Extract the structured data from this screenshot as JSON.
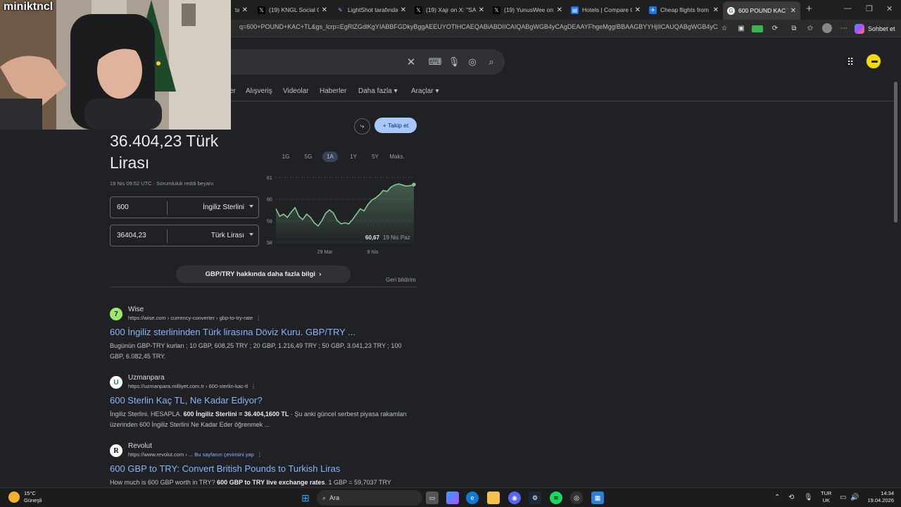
{
  "browser": {
    "tabs": [
      {
        "title": "tarafından",
        "icon": "lightshot-icon",
        "color": "#a06cd5"
      },
      {
        "title": "(19) KNGL Social Co",
        "icon": "x-icon",
        "color": "#000000"
      },
      {
        "title": "LightShot tarafından",
        "icon": "lightshot-icon",
        "color": "#a06cd5"
      },
      {
        "title": "(19) Xajr on X: \"SAD",
        "icon": "x-icon",
        "color": "#000000"
      },
      {
        "title": "(19) YunusWee on X",
        "icon": "x-icon",
        "color": "#000000"
      },
      {
        "title": "Hotels | Compare Ch",
        "icon": "hotels-icon",
        "color": "#1a73e8"
      },
      {
        "title": "Cheap flights from",
        "icon": "flights-icon",
        "color": "#1a73e8"
      },
      {
        "title": "600 POUND KAC TL",
        "icon": "google-icon",
        "color": "#ffffff",
        "active": true
      }
    ],
    "url": "q=600+POUND+KAC+TL&gs_lcrp=EgRlZGdlKgYIABBFGDkyBggAEEUYOTIHCAEQABiABDIICAIQABgWGB4yCAgDEAAYFhgeMggIBBAAGBYYHjIICAUQABgWGB4yCAgG...",
    "copilot_label": "Sohbet et"
  },
  "search": {
    "nav": [
      "er",
      "Alışveriş",
      "Videolar",
      "Haberler",
      "Daha fazla",
      "Araçlar"
    ],
    "follow_label": "Takip et"
  },
  "converter": {
    "result_line1": "36.404,23 Türk",
    "result_line2": "Lirası",
    "stamp": "19 Nis 09:52 UTC · Sorumluluk reddi beyanı",
    "from_amount": "600",
    "from_currency": "İngiliz Sterlini",
    "to_amount": "36404,23",
    "to_currency": "Türk Lirası",
    "ranges": [
      "1G",
      "5G",
      "1A",
      "1Y",
      "5Y",
      "Maks."
    ],
    "selected_range": "1A",
    "more_info": "GBP/TRY hakkında daha fazla bilgi",
    "feedback": "Geri bildirim"
  },
  "chart_data": {
    "type": "line",
    "title": "",
    "x_labels": [
      "29 Mar",
      "9 Nis"
    ],
    "y_ticks": [
      58,
      59,
      60,
      61
    ],
    "ylim": [
      58,
      61
    ],
    "values": [
      59.55,
      59.2,
      59.3,
      59.15,
      59.4,
      59.6,
      59.2,
      59.05,
      59.3,
      59.15,
      58.9,
      58.75,
      59.0,
      59.35,
      59.5,
      59.35,
      59.0,
      58.85,
      58.9,
      58.85,
      59.05,
      59.3,
      59.55,
      59.45,
      59.75,
      59.95,
      60.05,
      60.2,
      60.4,
      60.35,
      60.55,
      60.65,
      60.7,
      60.65,
      60.6,
      60.62,
      60.67
    ],
    "current_value": "60,67",
    "current_date": "19 Nis Paz",
    "line_color": "#81c995"
  },
  "results": [
    {
      "site": "Wise",
      "url": "https://wise.com › currency-converter › gbp-to-try-rate",
      "url_extra": "",
      "title": "600 İngiliz sterlininden Türk lirasına Döviz Kuru. GBP/TRY ...",
      "snippet_plain": "Bugünün GBP-TRY kurları ; 10 GBP, 608,25 TRY ; 20 GBP, 1.216,49 TRY ; 50 GBP, 3.041,23 TRY ; 100 GBP, 6.082,45 TRY.",
      "logo_color": "#9fe870",
      "logo_char": "7"
    },
    {
      "site": "Uzmanpara",
      "url": "https://uzmanpara.milliyet.com.tr › 600-sterlin-kac-tl",
      "url_extra": "",
      "title": "600 Sterlin Kaç TL, Ne Kadar Ediyor?",
      "snippet_a": "İngiliz Sterlini. HESAPLA. ",
      "snippet_b": "600 İngiliz Sterlini = 36.404,1600 TL",
      "snippet_c": " · Şu anki güncel serbest piyasa rakamları üzerinden 600 İngiliz Sterlini Ne Kadar Eder öğrenmek ...",
      "logo_color": "#ffffff",
      "logo_char": "U"
    },
    {
      "site": "Revolut",
      "url": "https://www.revolut.com › ... ",
      "url_extra": "Bu sayfanın çevirisini yap",
      "title": "600 GBP to TRY: Convert British Pounds to Turkish Liras",
      "snippet_a": "How much is 600 GBP worth in TRY? ",
      "snippet_b": "600 GBP to TRY live exchange rates",
      "snippet_c": ". 1 GBP = 59,7037 TRY",
      "logo_color": "#ffffff",
      "logo_char": "R"
    }
  ],
  "overlay": {
    "channel_name": "miniktncl"
  },
  "taskbar": {
    "temp": "15°C",
    "weather": "Güneşli",
    "search_label": "Ara",
    "lang_1": "TUR",
    "lang_2": "UK",
    "time": "14:34",
    "date": "19.04.2026"
  }
}
